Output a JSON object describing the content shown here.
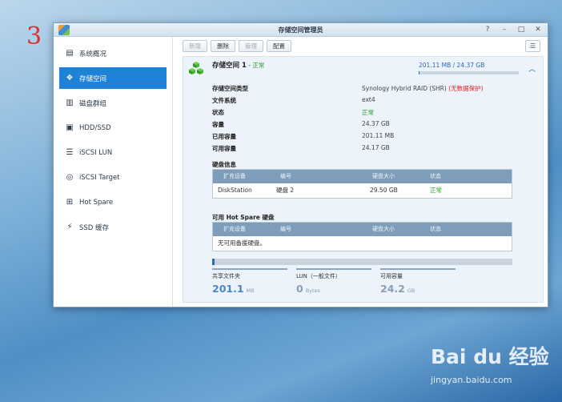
{
  "step_number": "3",
  "window": {
    "title": "存储空间管理员"
  },
  "colors": {
    "accent": "#1d82d8",
    "status_ok": "#2a9a2a",
    "warning": "#e02020"
  },
  "sidebar": {
    "items": [
      {
        "label": "系统概况",
        "icon": "overview-icon",
        "active": false
      },
      {
        "label": "存储空间",
        "icon": "volume-icon",
        "active": true
      },
      {
        "label": "磁盘群组",
        "icon": "disk-group-icon",
        "active": false
      },
      {
        "label": "HDD/SSD",
        "icon": "hdd-icon",
        "active": false
      },
      {
        "label": "iSCSI LUN",
        "icon": "database-icon",
        "active": false
      },
      {
        "label": "iSCSI Target",
        "icon": "globe-icon",
        "active": false
      },
      {
        "label": "Hot Spare",
        "icon": "plus-box-icon",
        "active": false
      },
      {
        "label": "SSD 缓存",
        "icon": "lightning-icon",
        "active": false
      }
    ]
  },
  "toolbar": {
    "create": "新增",
    "delete": "删除",
    "manage": "管理",
    "config": "配置"
  },
  "volume": {
    "title": "存储空间 1",
    "status_suffix": " - 正常",
    "capacity_text": "201.11 MB / 24.37 GB",
    "usage_fraction": 0.008,
    "properties": [
      {
        "label": "存储空间类型",
        "value": "Synology Hybrid RAID (SHR)",
        "extra": "(无数据保护)"
      },
      {
        "label": "文件系统",
        "value": "ext4"
      },
      {
        "label": "状态",
        "value": "正常"
      },
      {
        "label": "容量",
        "value": "24.37 GB"
      },
      {
        "label": "已用容量",
        "value": "201.11 MB"
      },
      {
        "label": "可用容量",
        "value": "24.17 GB"
      }
    ]
  },
  "disk_info": {
    "title": "硬盘信息",
    "headers": [
      "扩充设备",
      "编号",
      "硬盘大小",
      "状态"
    ],
    "rows": [
      [
        "DiskStation",
        "硬盘 2",
        "29.50 GB",
        "正常"
      ]
    ]
  },
  "hot_spare": {
    "title": "可用 Hot Spare 硬盘",
    "headers": [
      "扩充设备",
      "编号",
      "硬盘大小",
      "状态"
    ],
    "empty_text": "无可用备援硬盘。"
  },
  "stats": [
    {
      "label": "共享文件夹",
      "value": "201.1",
      "unit": "MB"
    },
    {
      "label": "LUN（一般文件）",
      "value": "0",
      "unit": "Bytes"
    },
    {
      "label": "可用容量",
      "value": "24.2",
      "unit": "GB"
    }
  ],
  "watermark": {
    "logo": "Bai du 经验",
    "url": "jingyan.baidu.com"
  }
}
